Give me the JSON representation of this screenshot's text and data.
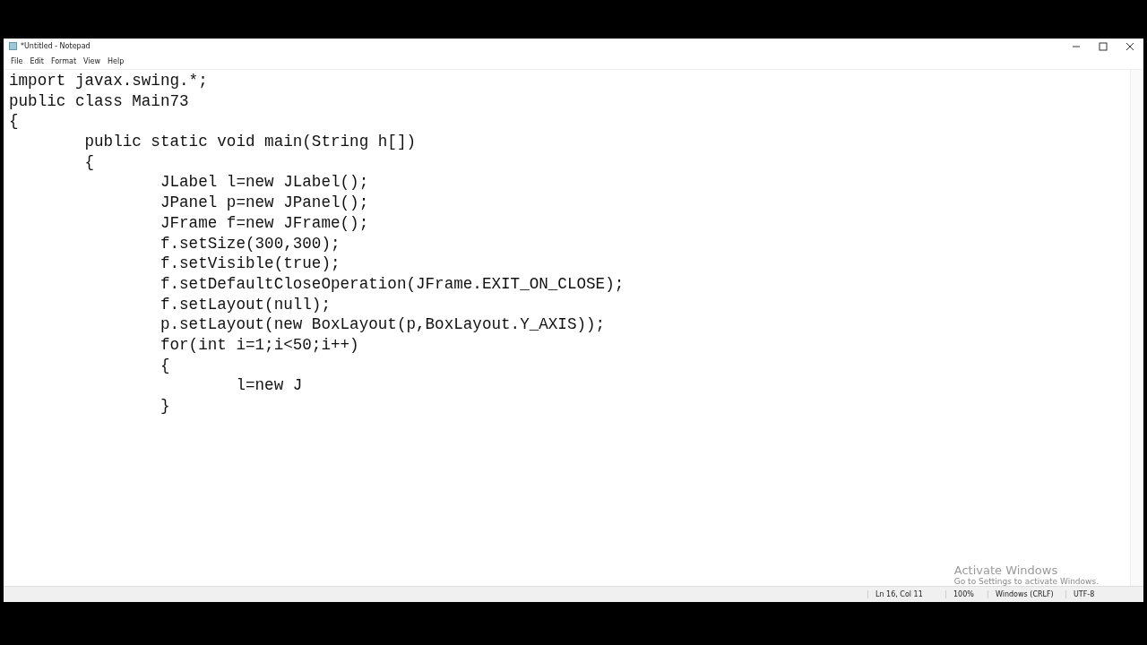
{
  "window": {
    "title": "*Untitled - Notepad"
  },
  "menu": [
    {
      "label": "File"
    },
    {
      "label": "Edit"
    },
    {
      "label": "Format"
    },
    {
      "label": "View"
    },
    {
      "label": "Help"
    }
  ],
  "editor": {
    "lines": [
      "import javax.swing.*;",
      "public class Main73",
      "{",
      "\tpublic static void main(String h[])",
      "\t{",
      "\t\tJLabel l=new JLabel();",
      "\t\tJPanel p=new JPanel();",
      "\t\tJFrame f=new JFrame();",
      "\t\tf.setSize(300,300);",
      "\t\tf.setVisible(true);",
      "\t\tf.setDefaultCloseOperation(JFrame.EXIT_ON_CLOSE);",
      "\t\tf.setLayout(null);",
      "\t\tp.setLayout(new BoxLayout(p,BoxLayout.Y_AXIS));",
      "\t\tfor(int i=1;i<50;i++)",
      "\t\t{",
      "\t\t\tl=new J",
      "\t\t}"
    ]
  },
  "activation_notice": {
    "title": "Activate Windows",
    "subtitle": "Go to Settings to activate Windows."
  },
  "status_bar": {
    "position": "Ln 16, Col 11",
    "zoom": "100%",
    "line_ending": "Windows (CRLF)",
    "encoding": "UTF-8"
  }
}
